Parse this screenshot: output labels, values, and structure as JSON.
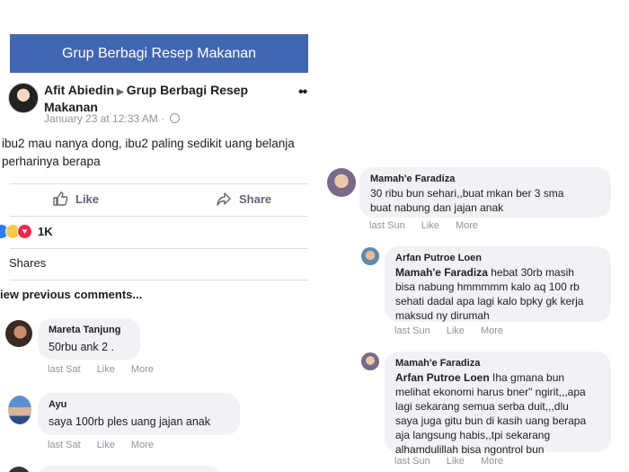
{
  "left": {
    "group_title": "Grup Berbagi Resep Makanan",
    "post": {
      "author": "Afit Abiedin",
      "group_line1": "Grup Berbagi Resep",
      "group_line2": "Makanan",
      "timestamp": "January 23 at 12:33 AM",
      "meta_sep": "·",
      "text_line1": "ibu2 mau nanya dong, ibu2 paling sedikit uang belanja",
      "text_line2": "perharinya berapa",
      "more": "••"
    },
    "actions": {
      "like": "Like",
      "share": "Share"
    },
    "reactions": {
      "count": "1K"
    },
    "shares": "Shares",
    "view_previous": "iew previous comments...",
    "comments": [
      {
        "name": "Mareta Tanjung",
        "text": "50rbu ank 2 .",
        "time": "last Sat",
        "like": "Like",
        "more": "More"
      },
      {
        "name": "Ayu",
        "text": "saya 100rb ples uang jajan anak",
        "time": "last Sat",
        "like": "Like",
        "more": "More"
      }
    ]
  },
  "right": {
    "comments": [
      {
        "name": "Mamah'e Faradiza",
        "lines": [
          "30 ribu bun sehari,,buat mkan ber 3 sma",
          "buat nabung dan jajan anak"
        ],
        "time": "last Sun",
        "like": "Like",
        "more": "More"
      },
      {
        "name": "Arfan Putroe Loen",
        "mention": "Mamah'e Faradiza",
        "lines": [
          " hebat 30rb masih",
          "bisa nabung hmmmmm kalo aq 100 rb",
          "sehati dadal apa lagi kalo bpky gk kerja",
          "maksud ny dirumah"
        ],
        "time": "last Sun",
        "like": "Like",
        "more": "More"
      },
      {
        "name": "Mamah'e Faradiza",
        "mention": "Arfan Putroe Loen",
        "lines": [
          " Iha gmana bun",
          "melihat ekonomi harus bner\" ngirit,,,apa",
          "lagi sekarang semua serba duit,,,dlu",
          "saya juga gitu bun di kasih uang berapa",
          "aja langsung habis,,tpi sekarang",
          "alhamdulillah bisa ngontrol bun"
        ],
        "time": "last Sun",
        "like": "Like",
        "more": "More"
      }
    ]
  },
  "colors": {
    "facebook_blue": "#4267b2",
    "bubble": "#f0f2f5",
    "meta_gray": "#90949c"
  }
}
